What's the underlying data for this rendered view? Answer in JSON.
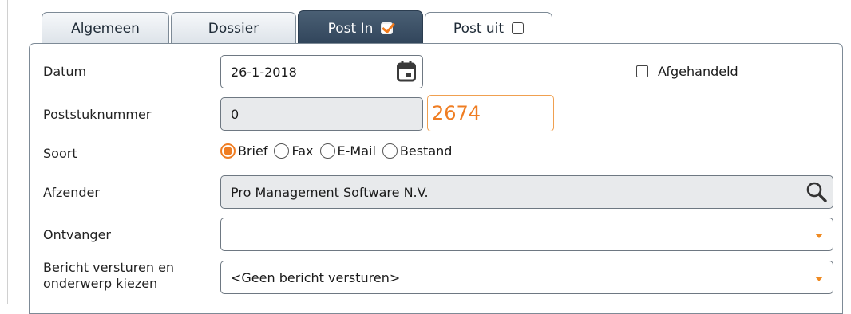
{
  "tabs": [
    {
      "label": "Algemeen",
      "active": false
    },
    {
      "label": "Dossier",
      "active": false
    },
    {
      "label": "Post In",
      "active": true,
      "checked": true
    },
    {
      "label": "Post uit",
      "active": false,
      "checked": false
    }
  ],
  "form": {
    "datum": {
      "label": "Datum",
      "value": "26-1-2018",
      "icon": "calendar-icon"
    },
    "afgehandeld": {
      "label": "Afgehandeld",
      "checked": false
    },
    "poststuknummer": {
      "label": "Poststuknummer",
      "value": "0",
      "number": "2674"
    },
    "soort": {
      "label": "Soort",
      "options": [
        "Brief",
        "Fax",
        "E-Mail",
        "Bestand"
      ],
      "selected": "Brief"
    },
    "afzender": {
      "label": "Afzender",
      "value": "Pro Management Software N.V.",
      "icon": "search-icon"
    },
    "ontvanger": {
      "label": "Ontvanger",
      "value": ""
    },
    "bericht": {
      "label_line1": "Bericht versturen en",
      "label_line2": "onderwerp kiezen",
      "value": "<Geen bericht versturen>"
    }
  },
  "colors": {
    "accent": "#ef7d22",
    "active_tab": "#3b5066",
    "readonly_bg": "#e8eaec",
    "border": "#6e7882"
  }
}
